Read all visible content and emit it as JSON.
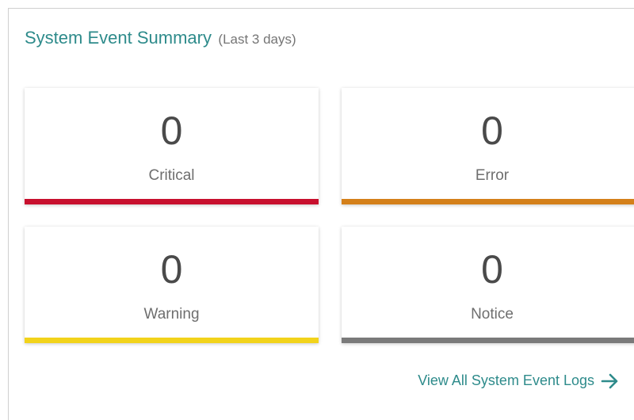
{
  "header": {
    "title": "System Event Summary",
    "subtitle": "(Last 3 days)"
  },
  "cards": [
    {
      "count": "0",
      "label": "Critical",
      "color": "#c8102e"
    },
    {
      "count": "0",
      "label": "Error",
      "color": "#d4801a"
    },
    {
      "count": "0",
      "label": "Warning",
      "color": "#f2d31b"
    },
    {
      "count": "0",
      "label": "Notice",
      "color": "#7a7a7a"
    }
  ],
  "footer": {
    "link_label": "View All System Event Logs",
    "link_icon": "arrow-right-icon",
    "accent_color": "#2e8b8b"
  }
}
